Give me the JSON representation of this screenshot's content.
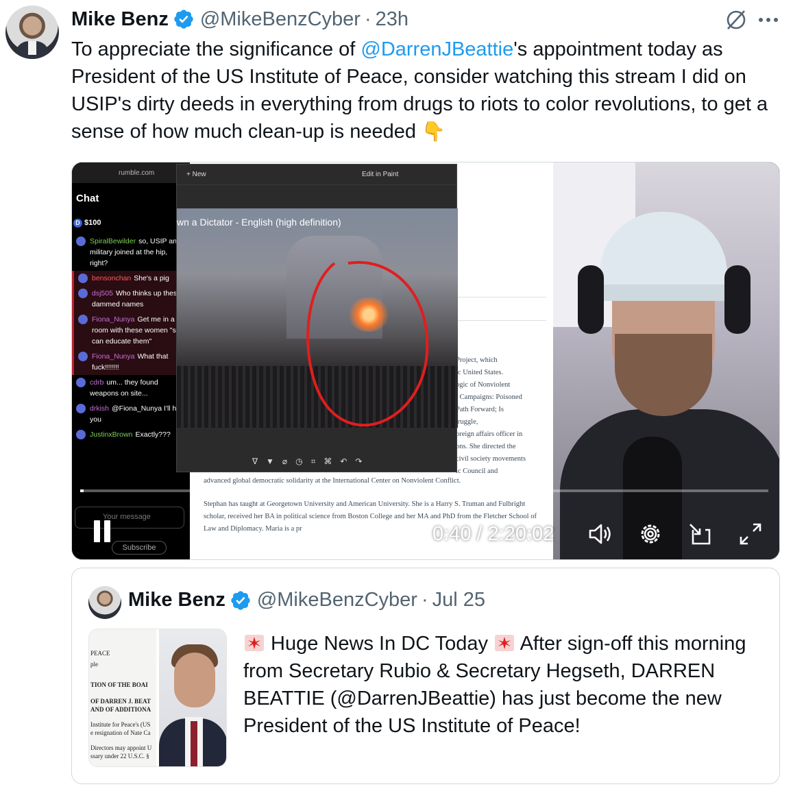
{
  "post": {
    "author_name": "Mike Benz",
    "author_handle": "@MikeBenzCyber",
    "separator": "·",
    "time": "23h",
    "text_before_mention": "To appreciate the significance of ",
    "mention": "@DarrenJBeattie",
    "text_after_mention": "'s appointment today as President of the US Institute of Peace, consider watching this stream I did on USIP's dirty deeds in everything from drugs to riots to color revolutions, to get a sense of how much clean-up is needed",
    "emoji": "👇"
  },
  "icons": {
    "verified": "verified-badge-icon",
    "grok": "grok-icon",
    "more": "more-icon"
  },
  "colors": {
    "link": "#1d9bf0",
    "muted": "#536471",
    "verified": "#1d9bf0",
    "text": "#0f1419"
  },
  "video": {
    "browser_url": "rumble.com",
    "chat_title": "Chat",
    "donation": "$100",
    "chat_messages": [
      {
        "user": "SpiralBewilder",
        "text": "so, USIP and military joined at the hip, right?",
        "style": "g"
      },
      {
        "user": "bensonchan",
        "text": "She's a pig",
        "style": "r",
        "highlight": true
      },
      {
        "user": "dsj505",
        "text": "Who thinks up these dammed names",
        "style": "",
        "highlight": true
      },
      {
        "user": "Fiona_Nunya",
        "text": "Get me in a room with these women \"so I can educate them\"",
        "style": "",
        "highlight": true
      },
      {
        "user": "Fiona_Nunya",
        "text": "What that fuck!!!!!!!",
        "style": "",
        "highlight": true
      },
      {
        "user": "cdrb",
        "text": "um... they found weapons on site...",
        "style": ""
      },
      {
        "user": "drkish",
        "text": "@Fiona_Nunya I'll help you",
        "style": ""
      },
      {
        "user": "JustinxBrown",
        "text": "Exactly???",
        "style": "g"
      }
    ],
    "chat_placeholder": "Your message",
    "subscribe_label": "Subscribe",
    "photo_new": "+ New",
    "photo_edit": "Edit in Paint",
    "photo_title": "wn a Dictator - English (high definition)",
    "doc_lines": [
      "Project, which",
      "ic United States.",
      "ogic of Nonviolent",
      "t Campaigns: Poisoned",
      "Path Forward; Is",
      "truggle,",
      "oreign affairs officer in",
      "ons. She directed the",
      "civil society movements",
      "ic Council and"
    ],
    "doc_para1": "advanced global democratic solidarity at the International Center on Nonviolent Conflict.",
    "doc_para2": "Stephan has taught at Georgetown University and American University. She is a Harry S. Truman and Fulbright scholar, received her BA in political science from Boston College and her MA and PhD from the Fletcher School of Law and Diplomacy. Maria is a pr",
    "timecode": "0:40 / 2:20:02",
    "progress_fraction": 0.005,
    "controls": [
      "pause-icon",
      "volume-icon",
      "settings-icon",
      "picture-in-picture-icon",
      "fullscreen-icon"
    ]
  },
  "quote": {
    "author_name": "Mike Benz",
    "author_handle": "@MikeBenzCyber",
    "separator": "·",
    "date": "Jul 25",
    "seg1": " Huge News In DC Today ",
    "seg2": " After sign-off this morning from Secretary Rubio & Secretary Hegseth, DARREN BEATTIE (@DarrenJBeattie) has just become the new President of the US Institute of Peace!",
    "siren_icon": "police-siren-icon",
    "doc_lines": [
      "PEACE",
      "ple",
      "TION OF THE BOAI",
      "OF DARREN J. BEAT",
      "AND OF ADDITIONA",
      "Institute for Peace's (US",
      "e resignation of Nate Ca",
      "Directors may appoint U",
      "ssary under 22 U.S.C. §"
    ]
  }
}
